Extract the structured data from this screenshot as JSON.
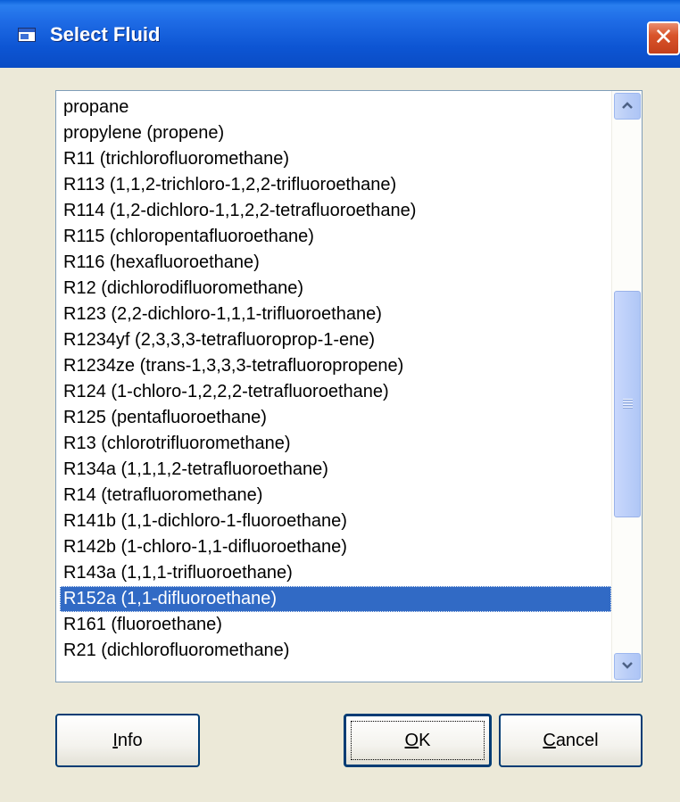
{
  "window": {
    "title": "Select Fluid",
    "close_glyph": "✕",
    "title_icon": "app-window-icon"
  },
  "list": {
    "selected_index": 19,
    "items": [
      "propane",
      "propylene (propene)",
      "R11 (trichlorofluoromethane)",
      "R113 (1,1,2-trichloro-1,2,2-trifluoroethane)",
      "R114 (1,2-dichloro-1,1,2,2-tetrafluoroethane)",
      "R115 (chloropentafluoroethane)",
      "R116 (hexafluoroethane)",
      "R12 (dichlorodifluoromethane)",
      "R123 (2,2-dichloro-1,1,1-trifluoroethane)",
      "R1234yf (2,3,3,3-tetrafluoroprop-1-ene)",
      "R1234ze (trans-1,3,3,3-tetrafluoropropene)",
      "R124 (1-chloro-1,2,2,2-tetrafluoroethane)",
      "R125 (pentafluoroethane)",
      "R13 (chlorotrifluoromethane)",
      "R134a (1,1,1,2-tetrafluoroethane)",
      "R14 (tetrafluoromethane)",
      "R141b (1,1-dichloro-1-fluoroethane)",
      "R142b (1-chloro-1,1-difluoroethane)",
      "R143a (1,1,1-trifluoroethane)",
      "R152a (1,1-difluoroethane)",
      "R161 (fluoroethane)",
      "R21 (dichlorofluoromethane)"
    ]
  },
  "buttons": {
    "info": {
      "mnemonic": "I",
      "rest": "nfo"
    },
    "ok": {
      "mnemonic": "O",
      "rest": "K"
    },
    "cancel": {
      "mnemonic": "C",
      "rest": "ancel"
    }
  },
  "colors": {
    "selection": "#316ac5",
    "titlebar": "#0a55d3",
    "dialog_bg": "#ece9d8"
  }
}
